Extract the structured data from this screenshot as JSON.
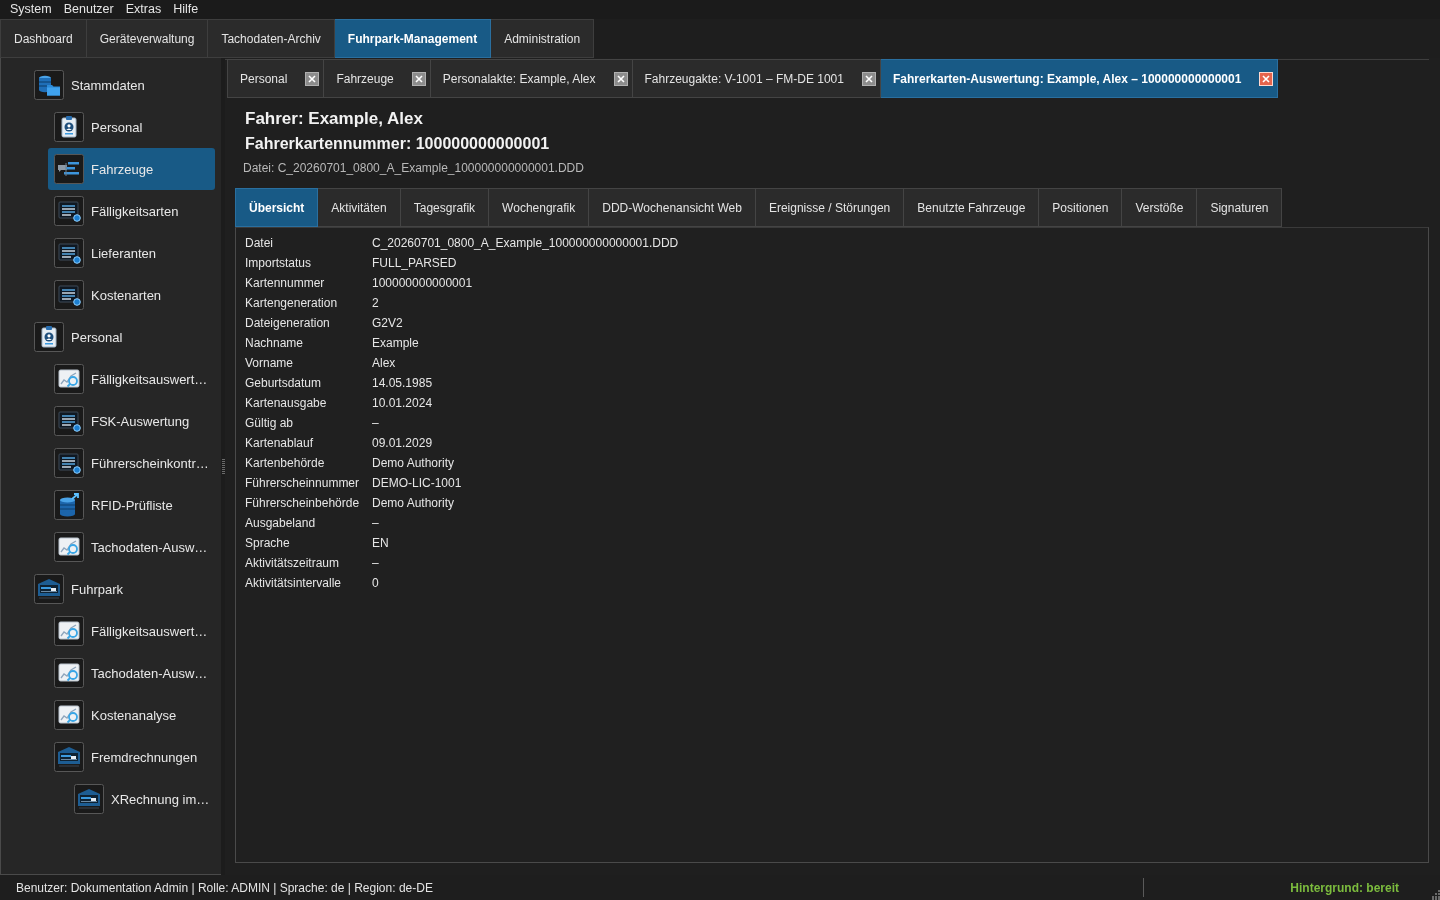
{
  "menu_bar": [
    "System",
    "Benutzer",
    "Extras",
    "Hilfe"
  ],
  "main_tabs": [
    {
      "label": "Dashboard",
      "selected": false
    },
    {
      "label": "Geräteverwaltung",
      "selected": false
    },
    {
      "label": "Tachodaten-Archiv",
      "selected": false
    },
    {
      "label": "Fuhrpark-Management",
      "selected": true
    },
    {
      "label": "Administration",
      "selected": false
    }
  ],
  "sidebar": {
    "tree": [
      {
        "label": "Stammdaten",
        "kind": "masterdata",
        "selected": false,
        "children": [
          {
            "label": "Personal",
            "kind": "personnel",
            "selected": false
          },
          {
            "label": "Fahrzeuge",
            "kind": "schedule",
            "selected": true
          },
          {
            "label": "Fälligkeitsarten",
            "kind": "table",
            "selected": false
          },
          {
            "label": "Lieferanten",
            "kind": "table",
            "selected": false
          },
          {
            "label": "Kostenarten",
            "kind": "table",
            "selected": false
          }
        ]
      },
      {
        "label": "Personal",
        "kind": "personnel",
        "selected": false,
        "children": [
          {
            "label": "Fälligkeitsauswert…",
            "kind": "analysis",
            "selected": false
          },
          {
            "label": "FSK-Auswertung",
            "kind": "table",
            "selected": false
          },
          {
            "label": "Führerscheinkontr…",
            "kind": "table",
            "selected": false
          },
          {
            "label": "RFID-Prüfliste",
            "kind": "export",
            "selected": false
          },
          {
            "label": "Tachodaten-Ausw…",
            "kind": "analysis",
            "selected": false
          }
        ]
      },
      {
        "label": "Fuhrpark",
        "kind": "fleet",
        "selected": false,
        "children": [
          {
            "label": "Fälligkeitsauswert…",
            "kind": "analysis",
            "selected": false
          },
          {
            "label": "Tachodaten-Ausw…",
            "kind": "analysis",
            "selected": false
          },
          {
            "label": "Kostenanalyse",
            "kind": "analysis",
            "selected": false
          },
          {
            "label": "Fremdrechnungen",
            "kind": "fleet",
            "selected": false,
            "children": [
              {
                "label": "XRechnung im…",
                "kind": "fleet",
                "selected": false
              }
            ]
          }
        ]
      }
    ]
  },
  "document_tabs": [
    {
      "label": "Personal",
      "selected": false
    },
    {
      "label": "Fahrzeuge",
      "selected": false
    },
    {
      "label": "Personalakte: Example, Alex",
      "selected": false
    },
    {
      "label": "Fahrzeugakte: V-1001 – FM-DE 1001",
      "selected": false
    },
    {
      "label": "Fahrerkarten-Auswertung: Example, Alex – 100000000000001",
      "selected": true
    }
  ],
  "header": {
    "title": "Fahrer: Example, Alex",
    "subtitle": "Fahrerkartennummer: 100000000000001",
    "file": "Datei: C_20260701_0800_A_Example_100000000000001.DDD"
  },
  "detail_tabs": [
    {
      "label": "Übersicht",
      "selected": true
    },
    {
      "label": "Aktivitäten",
      "selected": false
    },
    {
      "label": "Tagesgrafik",
      "selected": false
    },
    {
      "label": "Wochengrafik",
      "selected": false
    },
    {
      "label": "DDD-Wochenansicht Web",
      "selected": false
    },
    {
      "label": "Ereignisse / Störungen",
      "selected": false
    },
    {
      "label": "Benutzte Fahrzeuge",
      "selected": false
    },
    {
      "label": "Positionen",
      "selected": false
    },
    {
      "label": "Verstöße",
      "selected": false
    },
    {
      "label": "Signaturen",
      "selected": false
    }
  ],
  "overview": {
    "rows": [
      {
        "label": "Datei",
        "value": "C_20260701_0800_A_Example_100000000000001.DDD"
      },
      {
        "label": "Importstatus",
        "value": "FULL_PARSED"
      },
      {
        "label": "Kartennummer",
        "value": "100000000000001"
      },
      {
        "label": "Kartengeneration",
        "value": "2"
      },
      {
        "label": "Dateigeneration",
        "value": "G2V2"
      },
      {
        "label": "Nachname",
        "value": "Example"
      },
      {
        "label": "Vorname",
        "value": "Alex"
      },
      {
        "label": "Geburtsdatum",
        "value": "14.05.1985"
      },
      {
        "label": "Kartenausgabe",
        "value": "10.01.2024"
      },
      {
        "label": "Gültig ab",
        "value": "–"
      },
      {
        "label": "Kartenablauf",
        "value": "09.01.2029"
      },
      {
        "label": "Kartenbehörde",
        "value": "Demo Authority"
      },
      {
        "label": "Führerscheinnummer",
        "value": "DEMO-LIC-1001"
      },
      {
        "label": "Führerscheinbehörde",
        "value": "Demo Authority"
      },
      {
        "label": "Ausgabeland",
        "value": "–"
      },
      {
        "label": "Sprache",
        "value": "EN"
      },
      {
        "label": "Aktivitätszeitraum",
        "value": "–"
      },
      {
        "label": "Aktivitätsintervalle",
        "value": "0"
      }
    ]
  },
  "status_bar": {
    "user_info": "Benutzer: Dokumentation Admin | Rolle: ADMIN | Sprache: de | Region: de-DE",
    "background_status": "Hintergrund: bereit"
  }
}
